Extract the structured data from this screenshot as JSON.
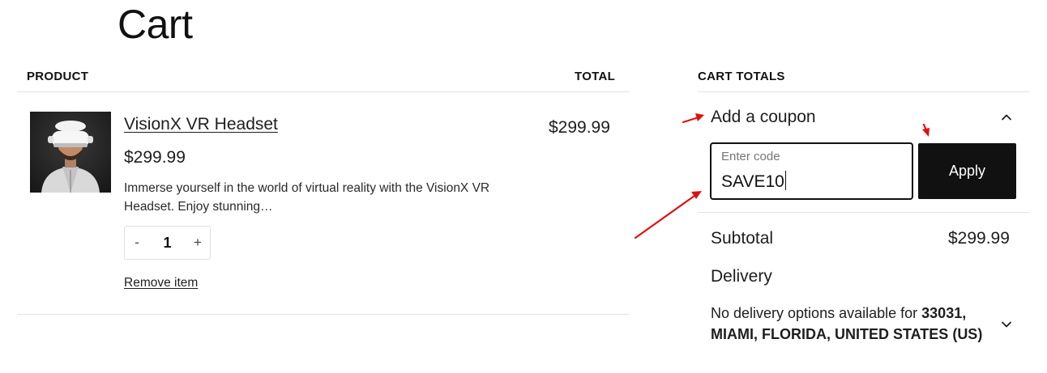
{
  "page": {
    "title": "Cart"
  },
  "table": {
    "product_header": "PRODUCT",
    "total_header": "TOTAL"
  },
  "item": {
    "name": "VisionX VR Headset",
    "price": "$299.99",
    "description": "Immerse yourself in the world of virtual reality with the VisionX VR Headset. Enjoy stunning…",
    "quantity": "1",
    "qty_minus": "-",
    "qty_plus": "+",
    "line_total": "$299.99",
    "remove_label": "Remove item"
  },
  "totals": {
    "header": "CART TOTALS",
    "coupon_toggle": "Add a coupon",
    "coupon_placeholder": "Enter code",
    "coupon_value": "SAVE10",
    "apply_label": "Apply",
    "subtotal_label": "Subtotal",
    "subtotal_value": "$299.99",
    "delivery_label": "Delivery",
    "delivery_msg_prefix": "No delivery options available for",
    "delivery_location_line1": "33031,",
    "delivery_location_line2": "MIAMI, FLORIDA, UNITED STATES (US)"
  },
  "icons": {
    "coupon_toggle": "chevron-up-icon",
    "delivery_toggle": "chevron-down-icon"
  },
  "colors": {
    "text": "#1e1e1e",
    "button_bg": "#111111",
    "button_text": "#ffffff",
    "divider": "#e2e2e2",
    "annotation_arrow": "#e01010"
  }
}
